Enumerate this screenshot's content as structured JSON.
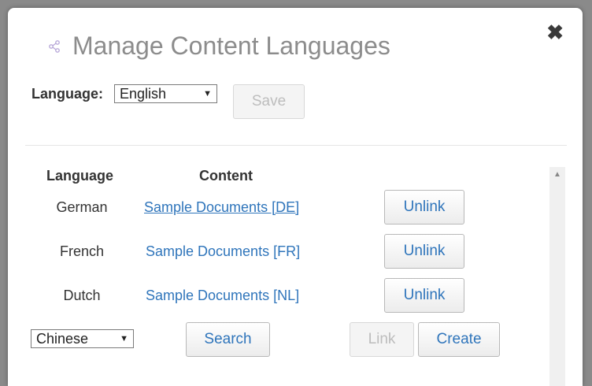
{
  "dialog": {
    "title": "Manage Content Languages",
    "close_glyph": "✖"
  },
  "language_selector": {
    "label": "Language:",
    "selected": "English",
    "save_label": "Save"
  },
  "table": {
    "headers": {
      "language": "Language",
      "content": "Content"
    },
    "rows": [
      {
        "language": "German",
        "content": "Sample Documents [DE]",
        "action": "Unlink"
      },
      {
        "language": "French",
        "content": "Sample Documents [FR]",
        "action": "Unlink"
      },
      {
        "language": "Dutch",
        "content": "Sample Documents [NL]",
        "action": "Unlink"
      }
    ]
  },
  "new_row": {
    "language_selected": "Chinese",
    "search_label": "Search",
    "link_label": "Link",
    "create_label": "Create"
  },
  "colors": {
    "link_blue": "#2f75bb",
    "title_gray": "#8c8c8c"
  },
  "icons": {
    "title_icon": "share-icon",
    "close_icon": "close-icon",
    "dropdown_icon": "chevron-down-icon",
    "scroll_up_icon": "scroll-up-arrow-icon"
  }
}
